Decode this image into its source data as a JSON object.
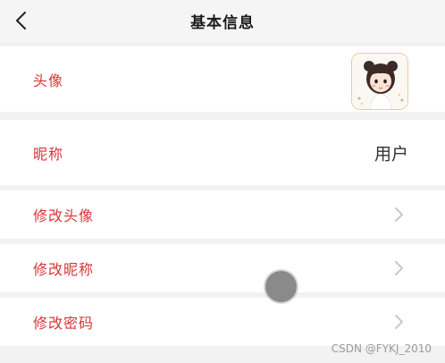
{
  "header": {
    "title": "基本信息"
  },
  "rows": {
    "avatar": {
      "label": "头像"
    },
    "nickname": {
      "label": "昵称",
      "value": "用户"
    },
    "edit_avatar": {
      "label": "修改头像"
    },
    "edit_nickname": {
      "label": "修改昵称"
    },
    "edit_password": {
      "label": "修改密码"
    }
  },
  "watermark": "CSDN @FYKJ_2010",
  "colors": {
    "label_red": "#d9343a",
    "background": "#f2f2f2",
    "row_background": "#ffffff",
    "avatar_border": "#f2c999",
    "chevron": "#c8c8c8"
  },
  "icons": {
    "back": "chevron-left-icon",
    "row_arrow": "chevron-right-icon"
  }
}
